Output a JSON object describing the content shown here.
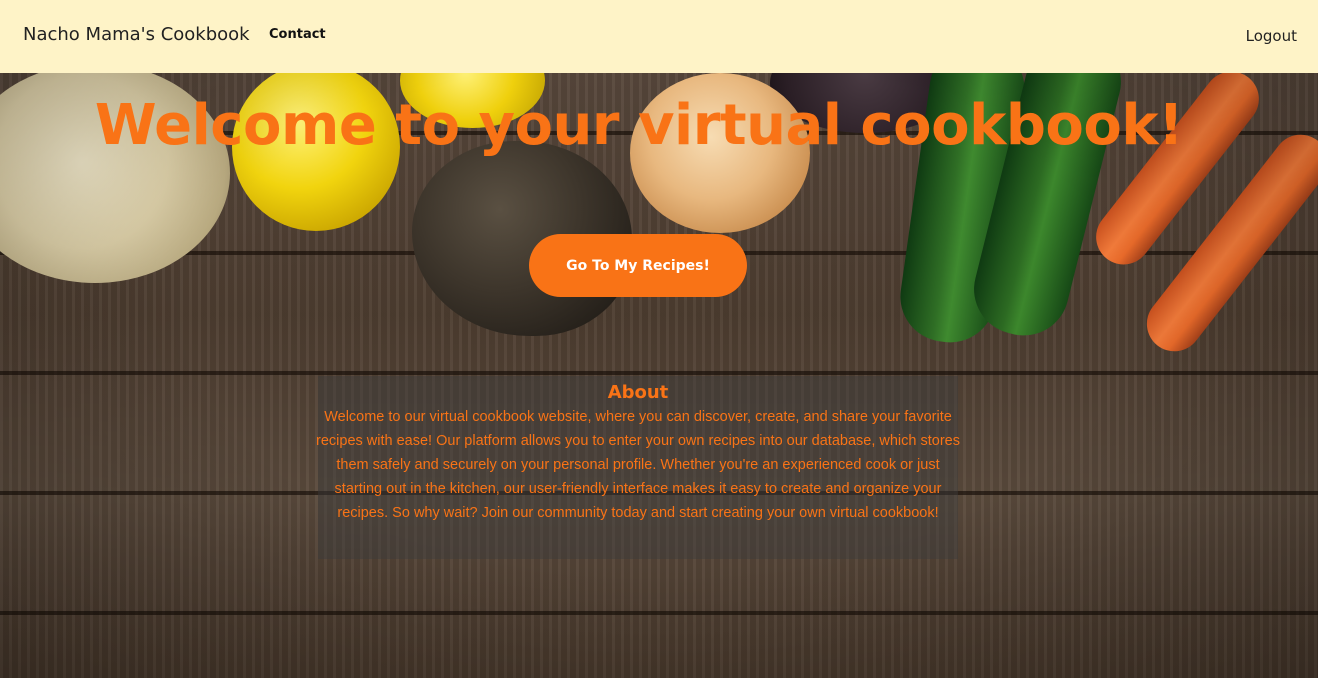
{
  "navbar": {
    "brand": "Nacho Mama's Cookbook",
    "links": [
      {
        "label": "Contact"
      }
    ],
    "logout_label": "Logout",
    "background_color": "#fef3c7"
  },
  "hero": {
    "title": "Welcome to your virtual cookbook!",
    "cta_label": "Go To My Recipes!",
    "accent_color": "#f97316"
  },
  "about": {
    "heading": "About",
    "body": "Welcome to our virtual cookbook website, where you can discover, create, and share your favorite recipes with ease! Our platform allows you to enter your own recipes into our database, which stores them safely and securely on your personal profile. Whether you're an experienced cook or just starting out in the kitchen, our user-friendly interface makes it easy to create and organize your recipes. So why wait? Join our community today and start creating your own virtual cookbook!"
  }
}
